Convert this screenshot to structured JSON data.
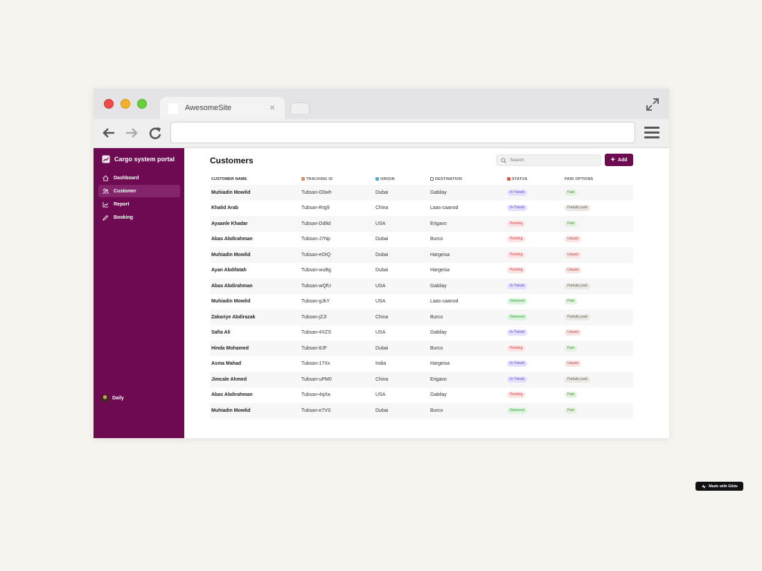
{
  "browser": {
    "tab_title": "AwesomeSite",
    "tab_close": "×",
    "url": ""
  },
  "sidebar": {
    "brand": "Cargo system portal",
    "items": [
      {
        "label": "Dashboard",
        "icon": "home-icon",
        "active": false
      },
      {
        "label": "Customer",
        "icon": "users-icon",
        "active": true
      },
      {
        "label": "Report",
        "icon": "chart-icon",
        "active": false
      },
      {
        "label": "Booking",
        "icon": "pencil-icon",
        "active": false
      }
    ],
    "user": "Daily"
  },
  "main": {
    "title": "Customers",
    "search_placeholder": "Search",
    "add_label": "Add",
    "columns": [
      "CUSTOMER NAME",
      "TRACKING ID",
      "ORIGIN",
      "DESTINATION",
      "STATUS",
      "PAID OPTIONS"
    ],
    "rows": [
      {
        "name": "Muhiadin Mowlid",
        "tracking": "Tubsan-O0wh",
        "origin": "Dubai",
        "destination": "Gabilay",
        "status": "In-Transit",
        "paid": "Paid"
      },
      {
        "name": "Khalid Arab",
        "tracking": "Tubsan-Rrg9",
        "origin": "China",
        "destination": "Laas-caanod",
        "status": "In-Transit",
        "paid": "Partially paid"
      },
      {
        "name": "Ayaanle Khadar",
        "tracking": "Tubsan-Dd8d",
        "origin": "USA",
        "destination": "Erigavo",
        "status": "Pending",
        "paid": "Paid"
      },
      {
        "name": "Abas Abdirahman",
        "tracking": "Tubsan-J7Np",
        "origin": "Dubai",
        "destination": "Burco",
        "status": "Pending",
        "paid": "Unpaid"
      },
      {
        "name": "Muhiadin Mowlid",
        "tracking": "Tubsan-eOIQ",
        "origin": "Dubai",
        "destination": "Hargeisa",
        "status": "Pending",
        "paid": "Unpaid"
      },
      {
        "name": "Ayan Abdifatah",
        "tracking": "Tubsan-wuBg",
        "origin": "Dubai",
        "destination": "Hargeisa",
        "status": "Pending",
        "paid": "Unpaid"
      },
      {
        "name": "Abas Abdirahman",
        "tracking": "Tubsan-wQfU",
        "origin": "USA",
        "destination": "Gabilay",
        "status": "In-Transit",
        "paid": "Partially paid"
      },
      {
        "name": "Muhiadin Mowlid",
        "tracking": "Tubsan-gJkY",
        "origin": "USA",
        "destination": "Laas-caanod",
        "status": "Delivered",
        "paid": "Paid"
      },
      {
        "name": "Zakariye Abdirazak",
        "tracking": "Tubsan-jZJl",
        "origin": "China",
        "destination": "Burco",
        "status": "Delivered",
        "paid": "Partially paid"
      },
      {
        "name": "Safia Ali",
        "tracking": "Tubsan-4XZS",
        "origin": "USA",
        "destination": "Gabilay",
        "status": "In-Transit",
        "paid": "Unpaid"
      },
      {
        "name": "Hinda Mohamed",
        "tracking": "Tubsan-8JF",
        "origin": "Dubai",
        "destination": "Burco",
        "status": "Pending",
        "paid": "Paid"
      },
      {
        "name": "Asma Mahad",
        "tracking": "Tubsan-17Xx",
        "origin": "India",
        "destination": "Hargeisa",
        "status": "In-Transit",
        "paid": "Unpaid"
      },
      {
        "name": "Jimcale Ahmed",
        "tracking": "Tubsan-uPM0",
        "origin": "China",
        "destination": "Erigavo",
        "status": "In-Transit",
        "paid": "Partially paid"
      },
      {
        "name": "Abas Abdirahman",
        "tracking": "Tubsan-4qXa",
        "origin": "USA",
        "destination": "Gabilay",
        "status": "Pending",
        "paid": "Paid"
      },
      {
        "name": "Muhiadin Mowlid",
        "tracking": "Tubsan-e7VS",
        "origin": "Dubai",
        "destination": "Burco",
        "status": "Delivered",
        "paid": "Paid"
      }
    ]
  },
  "status_colors": {
    "In-Transit": {
      "bg": "#e4e0ff",
      "fg": "#5a45d0"
    },
    "Pending": {
      "bg": "#fde2e2",
      "fg": "#d2404a"
    },
    "Delivered": {
      "bg": "#ddf5dd",
      "fg": "#3a9a45"
    }
  },
  "paid_colors": {
    "Paid": {
      "bg": "#e3f3df",
      "fg": "#4f8a3e"
    },
    "Unpaid": {
      "bg": "#fbe4e4",
      "fg": "#b8474f"
    },
    "Partially paid": {
      "bg": "#ece9e4",
      "fg": "#6b6258"
    }
  },
  "accent": "#6e0a52",
  "footer": {
    "glide": "Made with Glide"
  }
}
